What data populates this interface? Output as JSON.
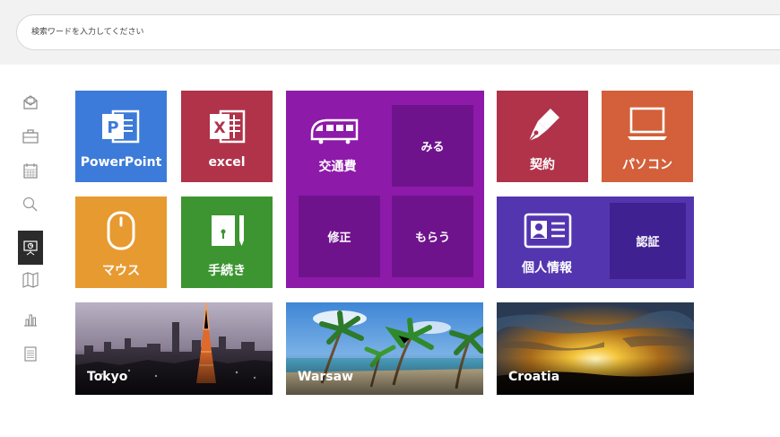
{
  "search": {
    "placeholder": "検索ワードを入力してください"
  },
  "sidebar": {
    "items": [
      {
        "icon": "mail-icon"
      },
      {
        "icon": "briefcase-icon"
      },
      {
        "icon": "calendar-icon"
      },
      {
        "icon": "search-icon"
      },
      {
        "icon": "presentation-icon",
        "active": true
      },
      {
        "icon": "map-icon"
      },
      {
        "icon": "chart-icon"
      },
      {
        "icon": "clipboard-icon"
      }
    ]
  },
  "tiles": {
    "powerpoint": {
      "label": "PowerPoint",
      "color": "#3c7bd9"
    },
    "excel": {
      "label": "excel",
      "color": "#b0334a"
    },
    "transport": {
      "label": "交通費",
      "color": "#8e1aa9",
      "sub_color": "#6f138c",
      "view": "みる",
      "fix": "修正",
      "receive": "もらう"
    },
    "contract": {
      "label": "契約",
      "color": "#b0334a"
    },
    "pc": {
      "label": "パソコン",
      "color": "#d3603a"
    },
    "mouse": {
      "label": "マウス",
      "color": "#e79a30"
    },
    "procedure": {
      "label": "手続き",
      "color": "#3c9531"
    },
    "personal": {
      "label": "個人情報",
      "color": "#5335b0",
      "sub_color": "#3f2192",
      "auth": "認証"
    }
  },
  "photos": [
    {
      "caption": "Tokyo"
    },
    {
      "caption": "Warsaw"
    },
    {
      "caption": "Croatia"
    }
  ]
}
